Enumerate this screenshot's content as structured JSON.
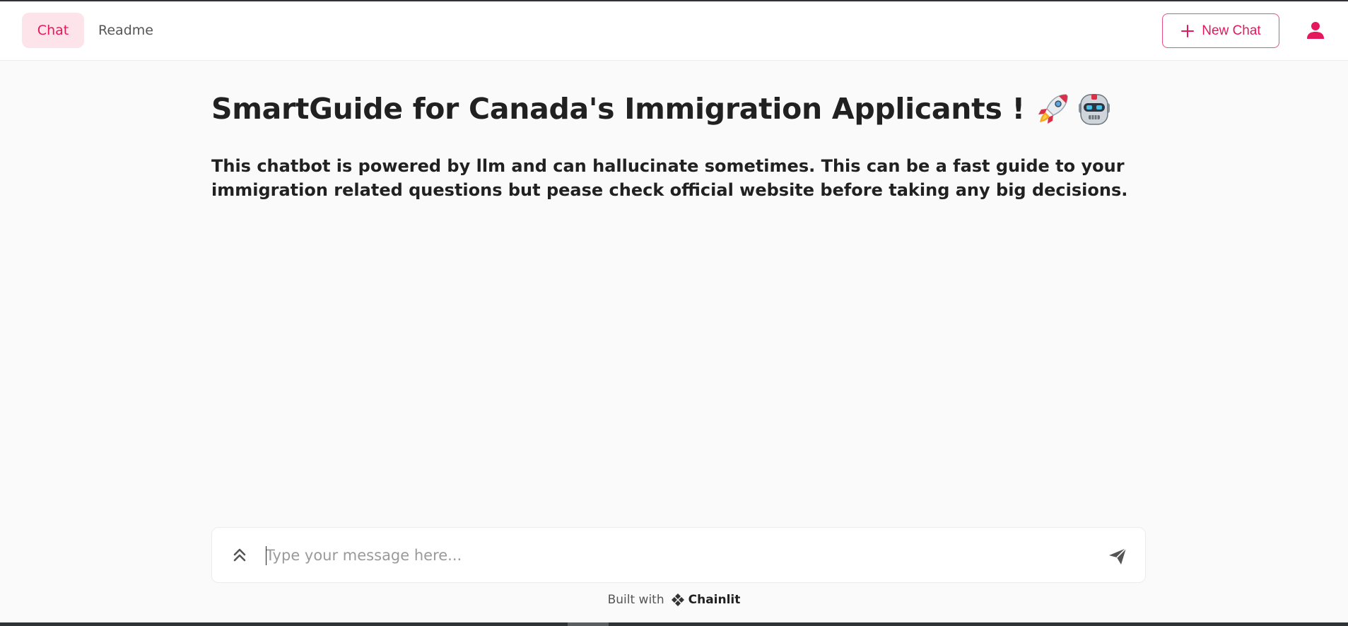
{
  "header": {
    "tabs": [
      {
        "label": "Chat",
        "active": true
      },
      {
        "label": "Readme",
        "active": false
      }
    ],
    "new_chat_label": "New Chat",
    "icons": {
      "new_chat": "plus-icon",
      "user": "user-avatar-icon"
    }
  },
  "main": {
    "title": "SmartGuide for Canada's Immigration Applicants !",
    "title_emojis": [
      "rocket-emoji",
      "robot-emoji"
    ],
    "description": "This chatbot is powered by llm and can hallucinate sometimes. This can be a fast guide to your immigration related questions but pease check official website before taking any big decisions."
  },
  "composer": {
    "placeholder": "Type your message here...",
    "value": "",
    "icons": {
      "expand": "chevrons-up-icon",
      "send": "send-icon"
    }
  },
  "footer": {
    "built_with": "Built with",
    "brand": "Chainlit"
  },
  "colors": {
    "accent": "#e5175d",
    "accent_bg": "#fde4ea",
    "background": "#fafafa",
    "text": "#212121"
  }
}
